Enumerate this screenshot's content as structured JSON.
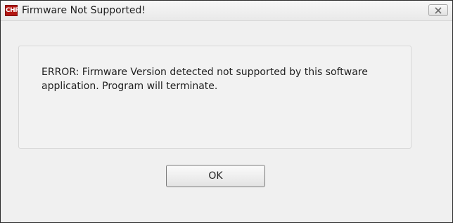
{
  "window": {
    "title": "Firmware Not Supported!",
    "app_icon": {
      "name": "app-logo-icon",
      "text": "CHR",
      "color": "#b31712"
    }
  },
  "dialog": {
    "message": "ERROR: Firmware Version detected not supported by this software application. Program will terminate.",
    "ok_label": "OK"
  },
  "icons": {
    "close": "close-icon"
  }
}
